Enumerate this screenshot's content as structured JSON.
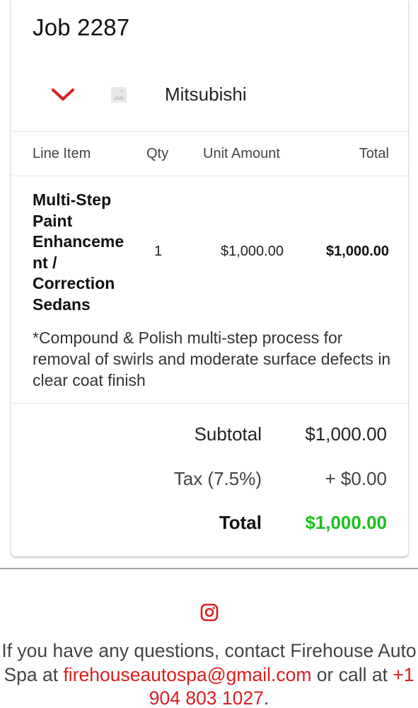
{
  "job": {
    "title": "Job 2287"
  },
  "vehicle": {
    "make": "Mitsubishi"
  },
  "table": {
    "headers": {
      "line_item": "Line Item",
      "qty": "Qty",
      "unit_amount": "Unit Amount",
      "total": "Total"
    },
    "rows": [
      {
        "name": "Multi-Step Paint Enhancement / Correction Sedans",
        "name_lines": [
          "Multi-Step",
          "Paint",
          "Enhanceme",
          "nt /",
          "Correction",
          "Sedans"
        ],
        "qty": "1",
        "unit_amount": "$1,000.00",
        "total": "$1,000.00",
        "description": "*Compound & Polish multi-step process for removal of swirls and moderate surface defects in clear coat finish"
      }
    ]
  },
  "summary": {
    "subtotal_label": "Subtotal",
    "subtotal_value": "$1,000.00",
    "tax_label": "Tax (7.5%)",
    "tax_value": "+ $0.00",
    "total_label": "Total",
    "total_value": "$1,000.00"
  },
  "footer": {
    "icon": "instagram-icon",
    "text_before": "If you have any questions, contact Firehouse Auto Spa at ",
    "email": "firehouseautospa@gmail.com",
    "text_middle": " or call at ",
    "phone": "+1 904 803 1027",
    "text_after": "."
  },
  "colors": {
    "accent_red": "#d81f1f",
    "total_green": "#19c01c",
    "text_dark": "#212121"
  }
}
